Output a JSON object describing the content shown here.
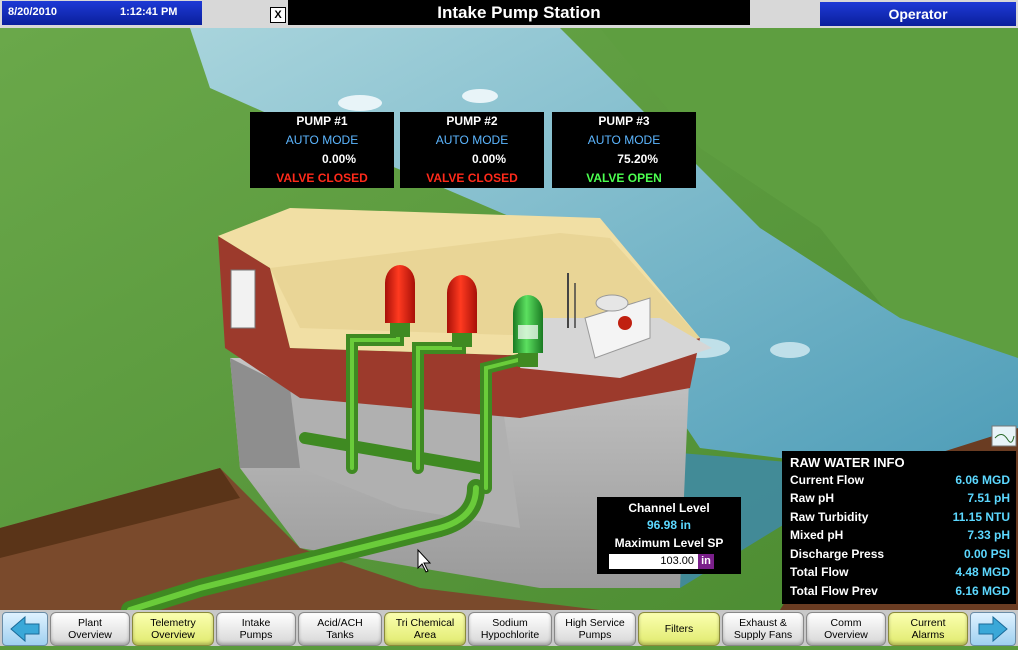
{
  "header": {
    "date": "8/20/2010",
    "time": "1:12:41 PM",
    "close_label": "X",
    "title": "Intake Pump Station",
    "user": "Operator"
  },
  "pumps": [
    {
      "name": "PUMP #1",
      "mode": "AUTO MODE",
      "speed": "0.00%",
      "valve": "VALVE CLOSED",
      "running": false
    },
    {
      "name": "PUMP #2",
      "mode": "AUTO MODE",
      "speed": "0.00%",
      "valve": "VALVE CLOSED",
      "running": false
    },
    {
      "name": "PUMP #3",
      "mode": "AUTO MODE",
      "speed": "75.20%",
      "valve": "VALVE OPEN",
      "running": true
    }
  ],
  "channel": {
    "label": "Channel Level",
    "value": "96.98 in",
    "sp_label": "Maximum Level SP",
    "sp_value": "103.00",
    "sp_unit": "in"
  },
  "raw_water": {
    "title": "RAW WATER INFO",
    "rows": [
      {
        "label": "Current Flow",
        "value": "6.06 MGD"
      },
      {
        "label": "Raw pH",
        "value": "7.51 pH"
      },
      {
        "label": "Raw Turbidity",
        "value": "11.15 NTU"
      },
      {
        "label": "Mixed pH",
        "value": "7.33 pH"
      },
      {
        "label": "Discharge Press",
        "value": "0.00 PSI"
      },
      {
        "label": "Total Flow",
        "value": "4.48 MGD"
      },
      {
        "label": "Total Flow Prev",
        "value": "6.16 MGD"
      }
    ]
  },
  "nav": {
    "back_icon": "left-arrow-icon",
    "forward_icon": "right-arrow-icon",
    "buttons": [
      {
        "l1": "Plant",
        "l2": "Overview",
        "style": "white"
      },
      {
        "l1": "Telemetry",
        "l2": "Overview",
        "style": "yellow"
      },
      {
        "l1": "Intake",
        "l2": "Pumps",
        "style": "white"
      },
      {
        "l1": "Acid/ACH",
        "l2": "Tanks",
        "style": "white"
      },
      {
        "l1": "Tri Chemical",
        "l2": "Area",
        "style": "yellow"
      },
      {
        "l1": "Sodium",
        "l2": "Hypochlorite",
        "style": "white"
      },
      {
        "l1": "High Service",
        "l2": "Pumps",
        "style": "white"
      },
      {
        "l1": "Filters",
        "l2": "",
        "style": "yellow"
      },
      {
        "l1": "Exhaust &",
        "l2": "Supply Fans",
        "style": "white"
      },
      {
        "l1": "Comm",
        "l2": "Overview",
        "style": "white"
      },
      {
        "l1": "Current",
        "l2": "Alarms",
        "style": "yellow"
      }
    ]
  },
  "colors": {
    "grass": "#5a9a3c",
    "water": "#6fb2c4",
    "pipe": "#5aa62e",
    "pump_off": "#e02a1a",
    "pump_on": "#2fae3a",
    "value_text": "#5cd8ff"
  }
}
